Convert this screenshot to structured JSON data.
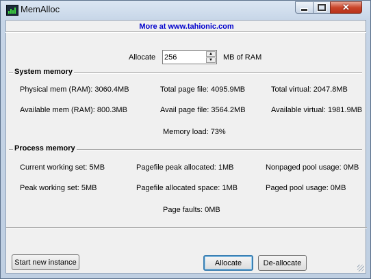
{
  "window": {
    "title": "MemAlloc"
  },
  "header": {
    "link_text": "More at www.tahionic.com"
  },
  "allocate": {
    "label": "Allocate",
    "value": "256",
    "unit": "MB of RAM"
  },
  "system_memory": {
    "title": "System memory",
    "physical": "Physical mem (RAM): 3060.4MB",
    "available": "Available mem (RAM): 800.3MB",
    "total_page": "Total page file: 4095.9MB",
    "avail_page": "Avail page file: 3564.2MB",
    "total_virtual": "Total virtual: 2047.8MB",
    "available_virtual": "Available virtual: 1981.9MB",
    "memory_load": "Memory load: 73%"
  },
  "process_memory": {
    "title": "Process memory",
    "current_ws": "Current working set: 5MB",
    "peak_ws": "Peak working set: 5MB",
    "pagefile_peak": "Pagefile peak allocated: 1MB",
    "pagefile_space": "Pagefile allocated space: 1MB",
    "nonpaged": "Nonpaged pool usage: 0MB",
    "paged": "Paged pool usage: 0MB",
    "page_faults": "Page faults: 0MB"
  },
  "buttons": {
    "start_new": "Start new instance",
    "allocate": "Allocate",
    "deallocate": "De-allocate"
  },
  "icons": {
    "app": "memory-chart-icon",
    "minimize": "minimize-icon",
    "maximize": "maximize-icon",
    "close": "close-icon",
    "spin_up": "chevron-up-icon",
    "spin_down": "chevron-down-icon"
  },
  "colors": {
    "link": "#0000cc",
    "close_button": "#c9452a",
    "default_button_border": "#3c7fb1"
  }
}
